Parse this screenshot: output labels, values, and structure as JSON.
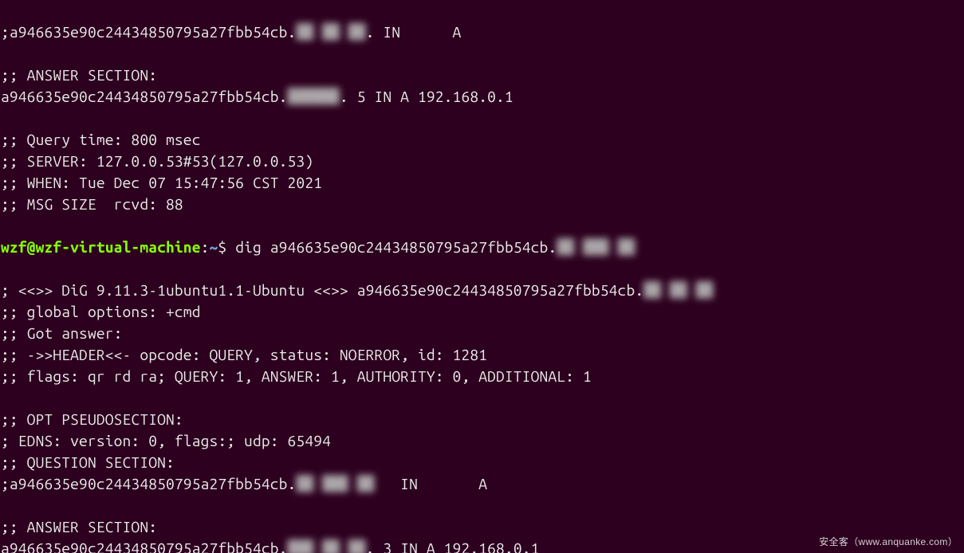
{
  "lines": {
    "l1_a": ";a946635e90c24434850795a27fbb54cb.",
    "l1_blur": "██ ██ ██",
    "l1_b": ". IN      A",
    "l2": "",
    "l3": ";; ANSWER SECTION:",
    "l4_a": "a946635e90c24434850795a27fbb54cb.",
    "l4_blur": "██████",
    "l4_b": ". 5 IN A 192.168.0.1",
    "l5": "",
    "l6": ";; Query time: 800 msec",
    "l7": ";; SERVER: 127.0.0.53#53(127.0.0.53)",
    "l8": ";; WHEN: Tue Dec 07 15:47:56 CST 2021",
    "l9": ";; MSG SIZE  rcvd: 88",
    "l10": "",
    "prompt_user": "wzf@wzf-virtual-machine",
    "prompt_colon": ":",
    "prompt_path": "~",
    "prompt_dollar": "$ ",
    "cmd_a": "dig a946635e90c24434850795a27fbb54cb.",
    "cmd_blur": "██ ███ ██",
    "l12": "",
    "l13_a": "; <<>> DiG 9.11.3-1ubuntu1.1-Ubuntu <<>> a946635e90c24434850795a27fbb54cb.",
    "l13_blur": "██ ██ ██",
    "l14": ";; global options: +cmd",
    "l15": ";; Got answer:",
    "l16": ";; ->>HEADER<<- opcode: QUERY, status: NOERROR, id: 1281",
    "l17": ";; flags: qr rd ra; QUERY: 1, ANSWER: 1, AUTHORITY: 0, ADDITIONAL: 1",
    "l18": "",
    "l19": ";; OPT PSEUDOSECTION:",
    "l20": "; EDNS: version: 0, flags:; udp: 65494",
    "l21": ";; QUESTION SECTION:",
    "l22_a": ";a946635e90c24434850795a27fbb54cb.",
    "l22_blur": "██ ███ ██",
    "l22_b": "   IN       A",
    "l23": "",
    "l24": ";; ANSWER SECTION:",
    "l25_a": "a946635e90c24434850795a27fbb54cb.",
    "l25_blur": "███ ██ ██",
    "l25_b": ". 3 IN A 192.168.0.1"
  },
  "watermark": "安全客（www.anquanke.com）"
}
